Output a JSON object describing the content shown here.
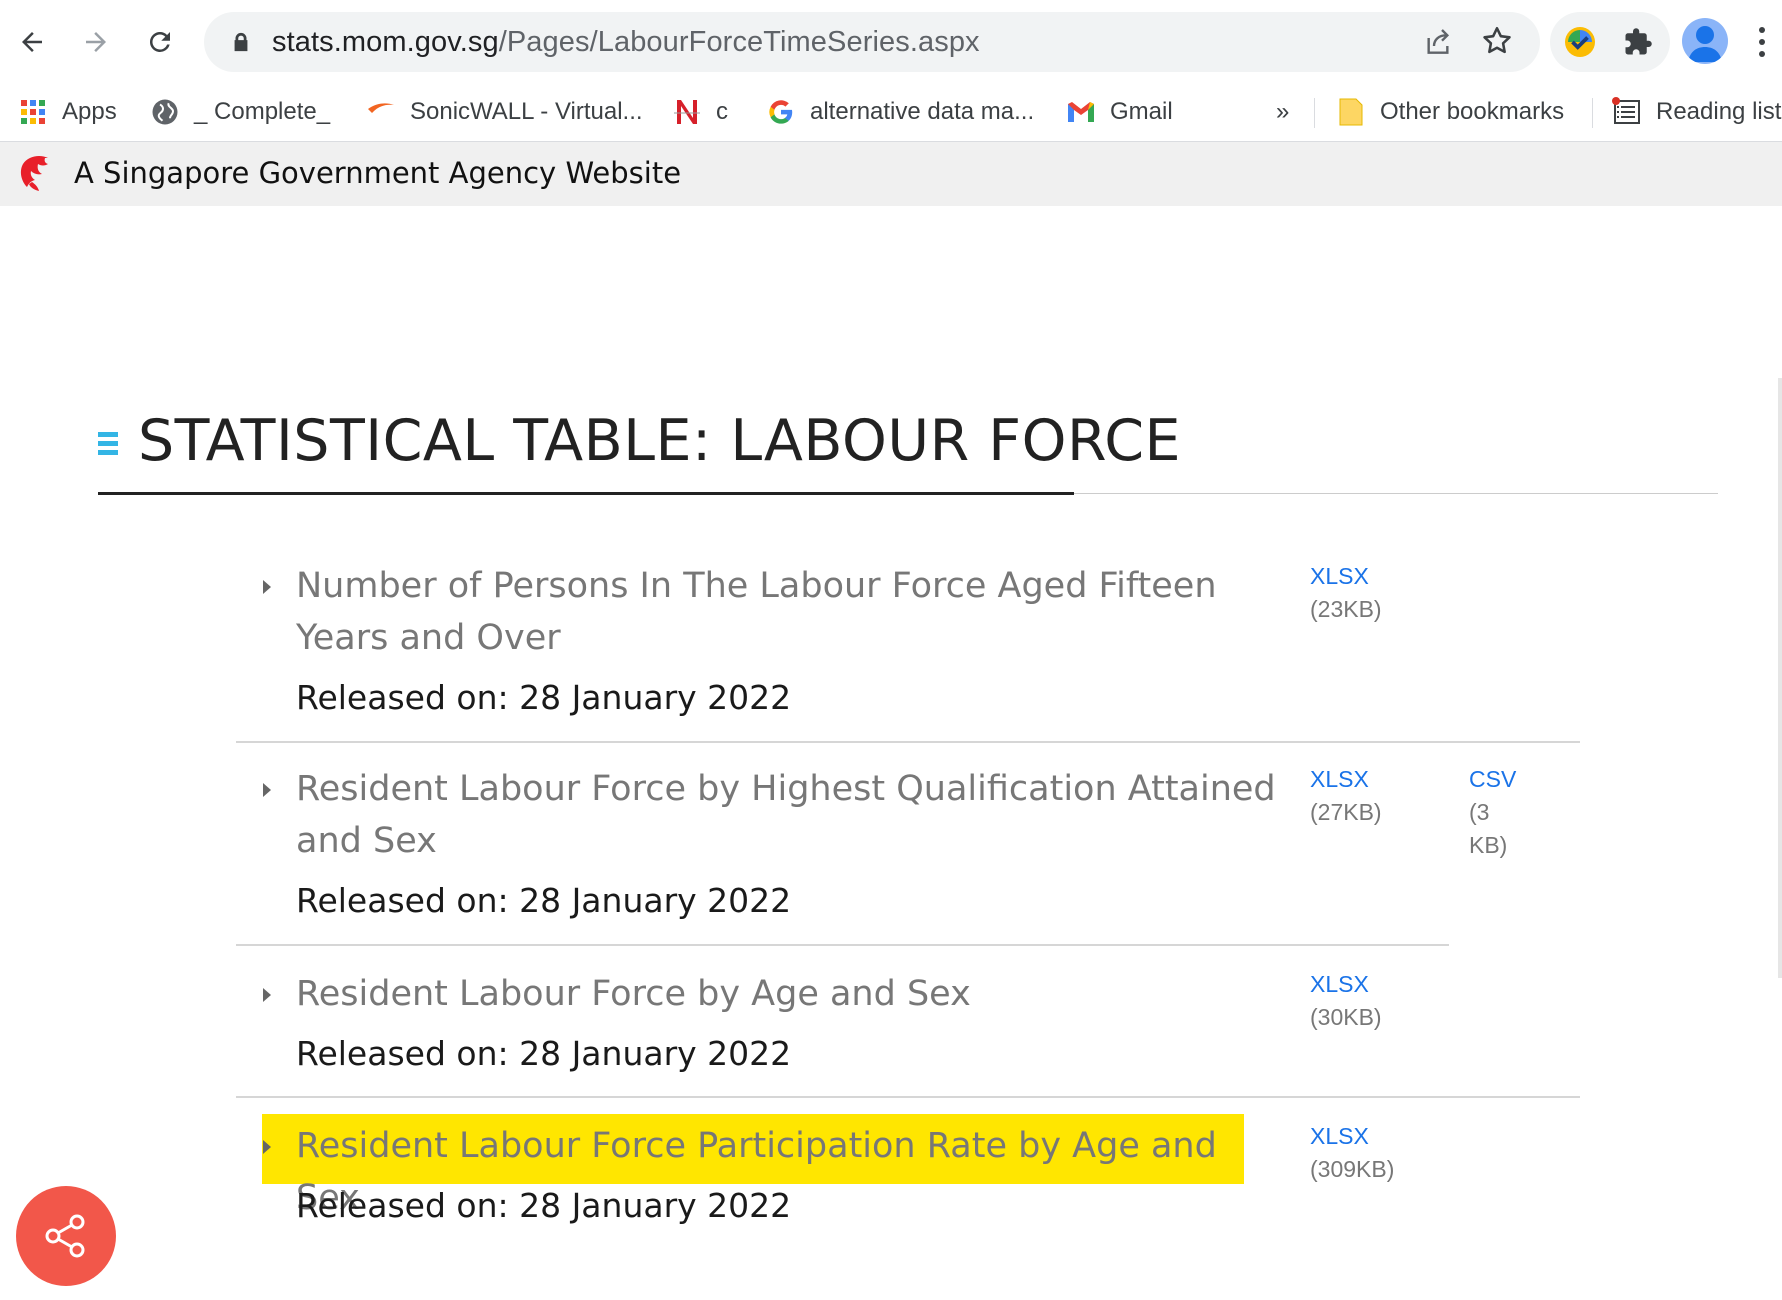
{
  "browser": {
    "url_host": "stats.mom.gov.sg",
    "url_path": "/Pages/LabourForceTimeSeries.aspx",
    "bookmarks": [
      {
        "label": "Apps",
        "icon": "apps-grid-icon"
      },
      {
        "label": "_ Complete_",
        "icon": "globe-icon"
      },
      {
        "label": "SonicWALL - Virtual...",
        "icon": "sonicwall-icon"
      },
      {
        "label": "c",
        "icon": "n-logo-icon"
      },
      {
        "label": "alternative data ma...",
        "icon": "google-icon"
      },
      {
        "label": "Gmail",
        "icon": "gmail-icon"
      }
    ],
    "overflow_label": "»",
    "other_bookmarks": "Other bookmarks",
    "reading_list": "Reading list"
  },
  "gov_banner": {
    "text": "A Singapore Government Agency Website"
  },
  "page": {
    "heading": "STATISTICAL TABLE: LABOUR FORCE",
    "items": [
      {
        "title": "Number of Persons In The Labour Force Aged Fifteen Years and Over",
        "released": "Released on: 28 January 2022",
        "downloads": [
          {
            "format": "XLSX",
            "size": "(23KB)"
          }
        ]
      },
      {
        "title": "Resident Labour Force by Highest Qualification Attained and Sex",
        "released": "Released on: 28 January 2022",
        "downloads": [
          {
            "format": "XLSX",
            "size": "(27KB)"
          },
          {
            "format": "CSV",
            "size_line1": "(3",
            "size_line2": "KB)"
          }
        ]
      },
      {
        "title": "Resident Labour Force by Age and Sex",
        "released": "Released on: 28 January 2022",
        "downloads": [
          {
            "format": "XLSX",
            "size": "(30KB)"
          }
        ]
      },
      {
        "title": "Resident Labour Force Participation Rate by Age and Sex",
        "released": "Released on: 28 January 2022",
        "highlighted": true,
        "downloads": [
          {
            "format": "XLSX",
            "size": "(309KB)"
          }
        ]
      }
    ]
  },
  "colors": {
    "link": "#1a73e8",
    "highlight": "#ffe600",
    "share_fab": "#f2574a",
    "heading_icon": "#33b5e5"
  }
}
